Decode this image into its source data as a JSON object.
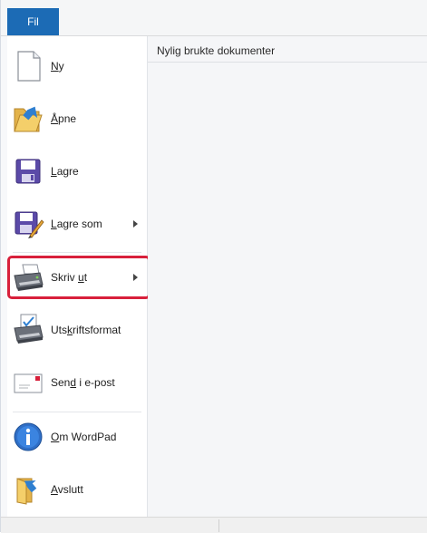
{
  "ribbon": {
    "file_tab_label": "Fil"
  },
  "menu": {
    "items": [
      {
        "label_pre": "",
        "label_ul": "N",
        "label_post": "y",
        "icon": "new-document-icon",
        "submenu": false
      },
      {
        "label_pre": "",
        "label_ul": "Å",
        "label_post": "pne",
        "icon": "open-folder-icon",
        "submenu": false
      },
      {
        "label_pre": "",
        "label_ul": "L",
        "label_post": "agre",
        "icon": "save-icon",
        "submenu": false
      },
      {
        "label_pre": "",
        "label_ul": "L",
        "label_post": "agre som",
        "icon": "save-as-icon",
        "submenu": true
      },
      {
        "label_pre": "Skriv ",
        "label_ul": "u",
        "label_post": "t",
        "icon": "printer-icon",
        "submenu": true
      },
      {
        "label_pre": "Uts",
        "label_ul": "k",
        "label_post": "riftsformat",
        "icon": "page-setup-icon",
        "submenu": false
      },
      {
        "label_pre": "Sen",
        "label_ul": "d",
        "label_post": " i e-post",
        "icon": "email-icon",
        "submenu": false
      },
      {
        "label_pre": "",
        "label_ul": "O",
        "label_post": "m WordPad",
        "icon": "info-icon",
        "submenu": false
      },
      {
        "label_pre": "",
        "label_ul": "A",
        "label_post": "vslutt",
        "icon": "exit-icon",
        "submenu": false
      }
    ]
  },
  "recent": {
    "title": "Nylig brukte dokumenter"
  },
  "colors": {
    "accent": "#1c6bb5",
    "highlight": "#d8203b"
  }
}
